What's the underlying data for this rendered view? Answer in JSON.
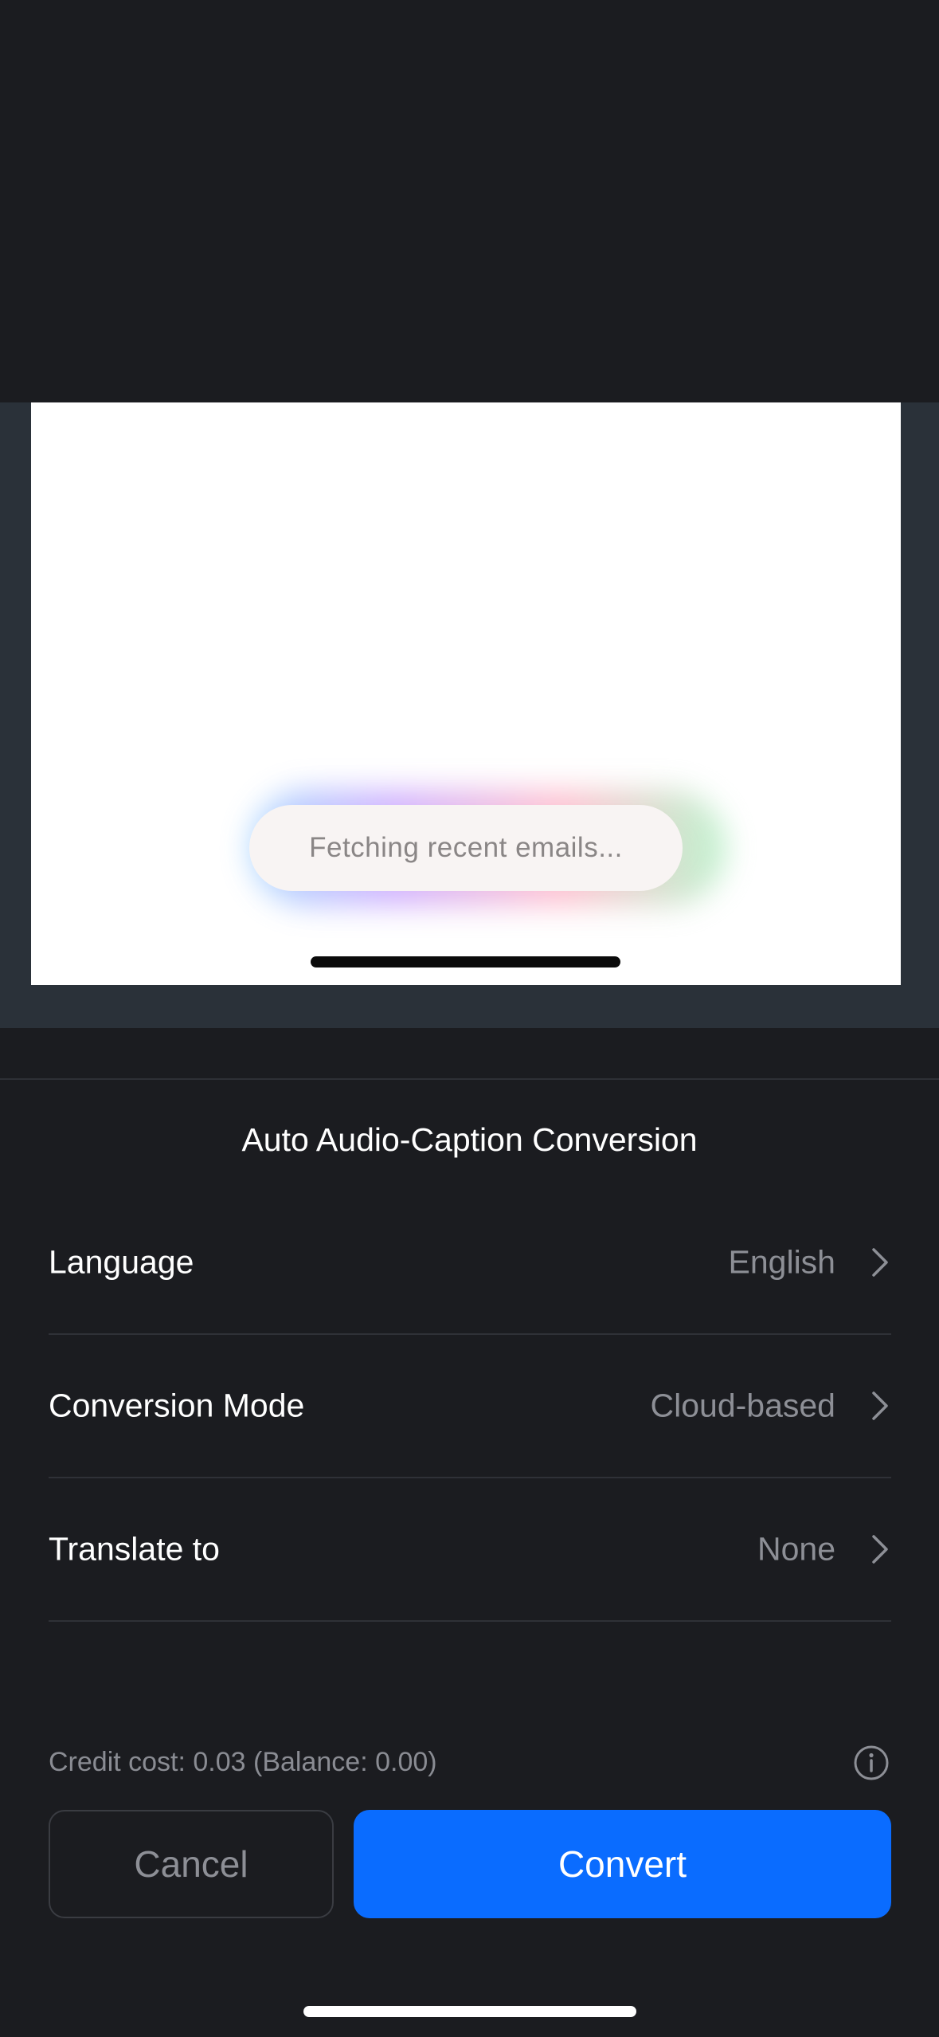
{
  "preview": {
    "status_toast": "Fetching recent emails..."
  },
  "sheet": {
    "title": "Auto Audio-Caption Conversion",
    "rows": [
      {
        "label": "Language",
        "value": "English"
      },
      {
        "label": "Conversion Mode",
        "value": "Cloud-based"
      },
      {
        "label": "Translate to",
        "value": "None"
      }
    ],
    "credit_text": "Credit cost: 0.03 (Balance: 0.00)",
    "cancel_label": "Cancel",
    "convert_label": "Convert"
  },
  "colors": {
    "background": "#1b1c20",
    "accent": "#0a6cff",
    "secondary_text": "#8d8f96"
  },
  "icons": [
    "chevron-right-icon",
    "info-icon"
  ]
}
